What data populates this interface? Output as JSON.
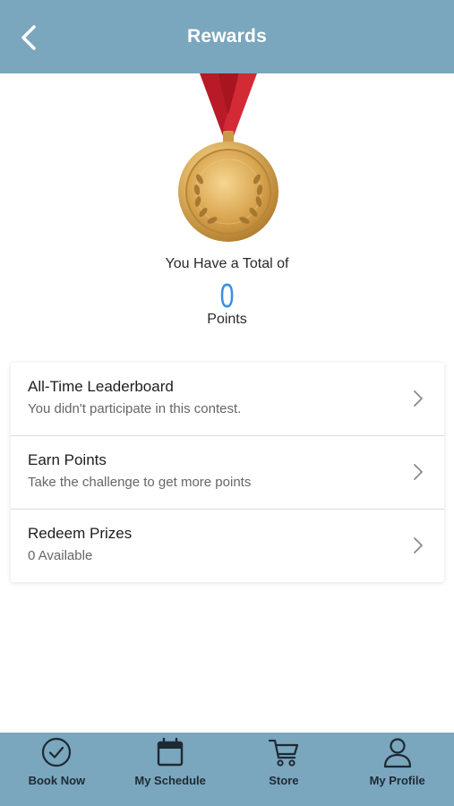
{
  "header": {
    "title": "Rewards",
    "back_icon": "chevron-left-icon"
  },
  "medal": {
    "icon": "gold-medal-icon",
    "colors": {
      "ribbon": "#c8202e",
      "gold": "#d8a54a"
    }
  },
  "points": {
    "label": "You Have a Total of",
    "value": "0",
    "unit": "Points"
  },
  "menu": {
    "items": [
      {
        "title": "All-Time Leaderboard",
        "subtitle": "You didn't participate in this contest."
      },
      {
        "title": "Earn Points",
        "subtitle": "Take the challenge to get more points"
      },
      {
        "title": "Redeem Prizes",
        "subtitle": "0 Available"
      }
    ]
  },
  "tabbar": {
    "tabs": [
      {
        "label": "Book Now",
        "icon": "check-circle-icon"
      },
      {
        "label": "My Schedule",
        "icon": "calendar-icon"
      },
      {
        "label": "Store",
        "icon": "cart-icon"
      },
      {
        "label": "My Profile",
        "icon": "user-icon"
      }
    ]
  },
  "colors": {
    "header": "#7aa6be",
    "accent": "#3b8fe0"
  }
}
